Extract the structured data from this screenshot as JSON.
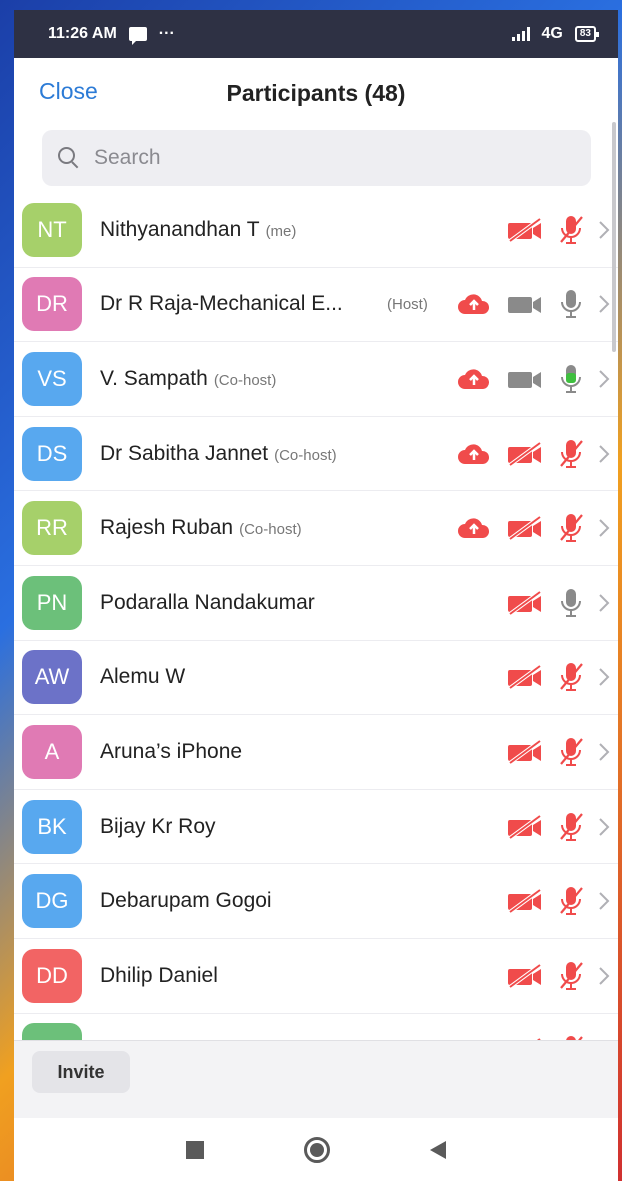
{
  "status": {
    "time": "11:26 AM",
    "dots": "···",
    "network": "4G",
    "battery": "83"
  },
  "header": {
    "close_label": "Close",
    "title": "Participants (48)"
  },
  "search": {
    "placeholder": "Search"
  },
  "colors": {
    "accent": "#2c7bd6",
    "muted_red": "#f04b4b",
    "neutral_gray": "#8a8a8a",
    "active_green": "#3fbf3f"
  },
  "participants": [
    {
      "initials": "NT",
      "name": "Nithyanandhan T",
      "role": "(me)",
      "host": "",
      "avatar": "#a6d06a",
      "cloud": false,
      "video": "off",
      "mic": "muted"
    },
    {
      "initials": "DR",
      "name": "Dr R Raja-Mechanical E...",
      "role": "",
      "host": "(Host)",
      "avatar": "#e07ab4",
      "cloud": true,
      "video": "on",
      "mic": "idle"
    },
    {
      "initials": "VS",
      "name": "V. Sampath",
      "role": "(Co-host)",
      "host": "",
      "avatar": "#58a8ef",
      "cloud": true,
      "video": "on",
      "mic": "active"
    },
    {
      "initials": "DS",
      "name": "Dr Sabitha Jannet",
      "role": "(Co-host)",
      "host": "",
      "avatar": "#58a8ef",
      "cloud": true,
      "video": "off",
      "mic": "muted"
    },
    {
      "initials": "RR",
      "name": "Rajesh Ruban",
      "role": "(Co-host)",
      "host": "",
      "avatar": "#a6d06a",
      "cloud": true,
      "video": "off",
      "mic": "muted"
    },
    {
      "initials": "PN",
      "name": "Podaralla Nandakumar",
      "role": "",
      "host": "",
      "avatar": "#6cc07a",
      "cloud": false,
      "video": "off",
      "mic": "idle"
    },
    {
      "initials": "AW",
      "name": "Alemu W",
      "role": "",
      "host": "",
      "avatar": "#6c72c8",
      "cloud": false,
      "video": "off",
      "mic": "muted"
    },
    {
      "initials": "A",
      "name": "Aruna’s iPhone",
      "role": "",
      "host": "",
      "avatar": "#e07ab4",
      "cloud": false,
      "video": "off",
      "mic": "muted"
    },
    {
      "initials": "BK",
      "name": "Bijay Kr Roy",
      "role": "",
      "host": "",
      "avatar": "#58a8ef",
      "cloud": false,
      "video": "off",
      "mic": "muted"
    },
    {
      "initials": "DG",
      "name": "Debarupam Gogoi",
      "role": "",
      "host": "",
      "avatar": "#58a8ef",
      "cloud": false,
      "video": "off",
      "mic": "muted"
    },
    {
      "initials": "DD",
      "name": "Dhilip Daniel",
      "role": "",
      "host": "",
      "avatar": "#f26464",
      "cloud": false,
      "video": "off",
      "mic": "muted"
    },
    {
      "initials": "",
      "name": "",
      "role": "",
      "host": "",
      "avatar": "#6cc07a",
      "cloud": false,
      "video": "off",
      "mic": "muted"
    }
  ],
  "footer": {
    "invite_label": "Invite"
  }
}
